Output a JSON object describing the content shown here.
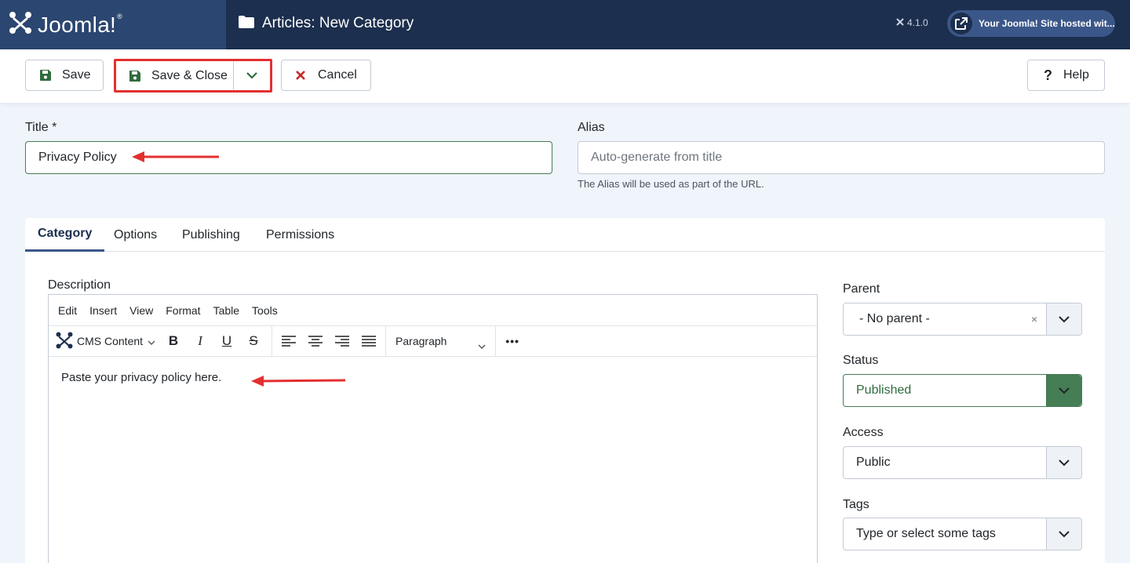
{
  "header": {
    "logo_text": "Joomla!",
    "logo_mark": "®",
    "page_title": "Articles: New Category",
    "version": "4.1.0",
    "site_link": "Your Joomla! Site hosted wit..."
  },
  "toolbar": {
    "save_label": "Save",
    "save_close_label": "Save & Close",
    "cancel_label": "Cancel",
    "help_label": "Help"
  },
  "form": {
    "title_label": "Title *",
    "title_value": "Privacy Policy",
    "alias_label": "Alias",
    "alias_placeholder": "Auto-generate from title",
    "alias_hint": "The Alias will be used as part of the URL."
  },
  "tabs": [
    {
      "label": "Category",
      "active": true
    },
    {
      "label": "Options",
      "active": false
    },
    {
      "label": "Publishing",
      "active": false
    },
    {
      "label": "Permissions",
      "active": false
    }
  ],
  "editor": {
    "label": "Description",
    "menu": [
      "Edit",
      "Insert",
      "View",
      "Format",
      "Table",
      "Tools"
    ],
    "cms_content": "CMS Content",
    "block_format": "Paragraph",
    "content": "Paste your privacy policy here."
  },
  "sidebar": {
    "parent_label": "Parent",
    "parent_value": "- No parent -",
    "status_label": "Status",
    "status_value": "Published",
    "access_label": "Access",
    "access_value": "Public",
    "tags_label": "Tags",
    "tags_placeholder": "Type or select some tags"
  },
  "colors": {
    "header_bg": "#1c2f4e",
    "logo_bg": "#2b4670",
    "highlight": "#e3302f",
    "success": "#457d54"
  }
}
